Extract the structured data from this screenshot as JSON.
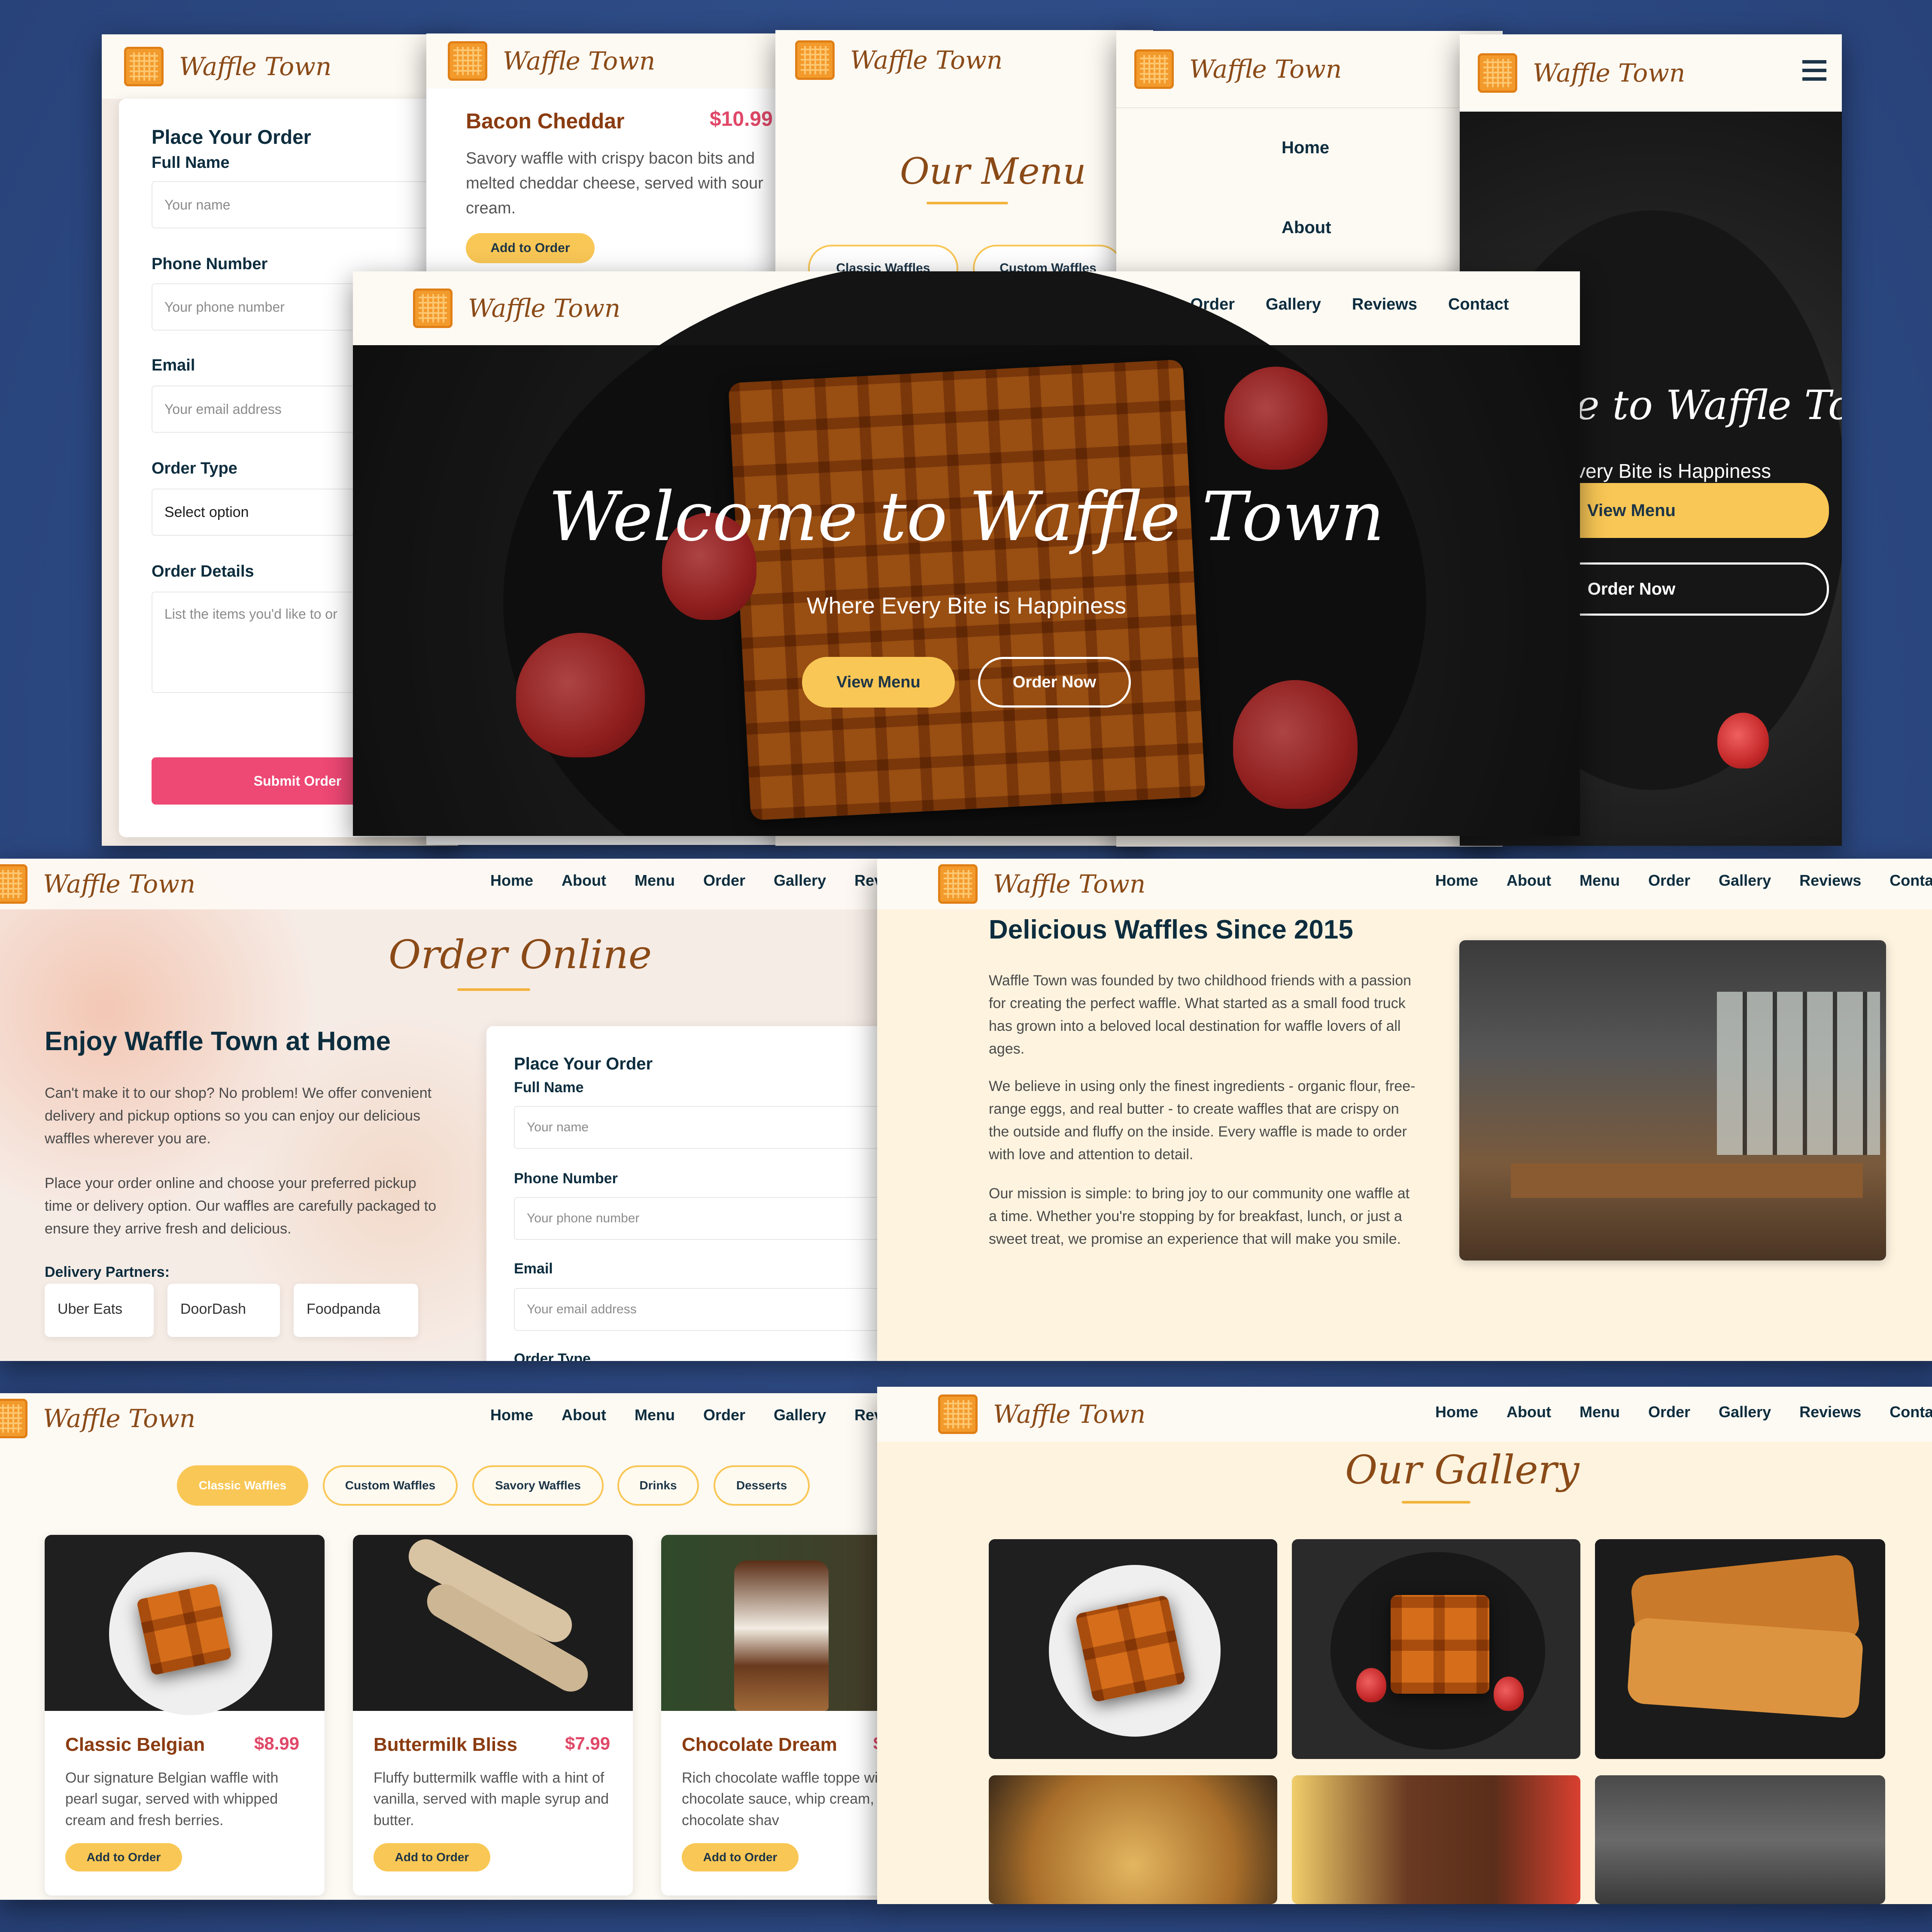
{
  "brand": {
    "name": "Waffle Town"
  },
  "nav": {
    "home": "Home",
    "about": "About",
    "menu": "Menu",
    "order": "Order",
    "gallery": "Gallery",
    "reviews": "Reviews",
    "contact": "Contact",
    "reviews_cut": "Rev",
    "contact_cut": "Contac"
  },
  "hero": {
    "title": "Welcome to Waffle Town",
    "title_cut": "e to Waffle Town",
    "subtitle": "Where Every Bite is Happiness",
    "subtitle_cut": "very Bite is Happiness",
    "view_menu": "View Menu",
    "order_now": "Order Now"
  },
  "order_form": {
    "title": "Place Your Order",
    "full_name_label": "Full Name",
    "full_name_placeholder": "Your name",
    "phone_label": "Phone Number",
    "phone_placeholder": "Your phone number",
    "email_label": "Email",
    "email_placeholder": "Your email address",
    "order_type_label": "Order Type",
    "order_type_value": "Select option",
    "order_type_cut": "Order Type",
    "details_label": "Order Details",
    "details_placeholder": "List the items you'd like to or",
    "submit": "Submit Order"
  },
  "bacon_card": {
    "title": "Bacon Cheddar",
    "price": "$10.99",
    "desc": "Savory waffle with crispy bacon bits and melted cheddar cheese, served with sour cream.",
    "button": "Add to Order"
  },
  "menu_section": {
    "title": "Our Menu",
    "chip_classic": "Classic Waffles",
    "chip_custom": "Custom Waffles",
    "chip_savory": "Savory Waffles",
    "chip_drinks": "Drinks",
    "chip_desserts": "Desserts"
  },
  "order_online": {
    "title": "Order Online",
    "heading": "Enjoy Waffle Town at Home",
    "p1": "Can't make it to our shop? No problem! We offer convenient delivery and pickup options so you can enjoy our delicious waffles wherever you are.",
    "p2": "Place your order online and choose your preferred pickup time or delivery option. Our waffles are carefully packaged to ensure they arrive fresh and delicious.",
    "partners_label": "Delivery Partners:",
    "partners": [
      "Uber Eats",
      "DoorDash",
      "Foodpanda"
    ]
  },
  "about": {
    "heading": "Delicious Waffles Since 2015",
    "p1": "Waffle Town was founded by two childhood friends with a passion for creating the perfect waffle. What started as a small food truck has grown into a beloved local destination for waffle lovers of all ages.",
    "p2": "We believe in using only the finest ingredients - organic flour, free-range eggs, and real butter - to create waffles that are crispy on the outside and fluffy on the inside. Every waffle is made to order with love and attention to detail.",
    "p3": "Our mission is simple: to bring joy to our community one waffle at a time. Whether you're stopping by for breakfast, lunch, or just a sweet treat, we promise an experience that will make you smile."
  },
  "menu_items": [
    {
      "title": "Classic Belgian",
      "price": "$8.99",
      "desc": "Our signature Belgian waffle with pearl sugar, served with whipped cream and fresh berries.",
      "button": "Add to Order"
    },
    {
      "title": "Buttermilk Bliss",
      "price": "$7.99",
      "desc": "Fluffy buttermilk waffle with a hint of vanilla, served with maple syrup and butter.",
      "button": "Add to Order"
    },
    {
      "title": "Chocolate Dream",
      "price": "$",
      "desc": "Rich chocolate waffle toppe with chocolate sauce, whip cream, and chocolate shav",
      "button": "Add to Order"
    }
  ],
  "gallery": {
    "title": "Our Gallery"
  },
  "colors": {
    "background": "#2f4c86",
    "accent_yellow": "#f9c755",
    "brand_brown": "#8a4a17",
    "price_pink": "#e04868",
    "submit_pink": "#ee4874",
    "heading_navy": "#0d2d3e",
    "cream": "#fdf3df"
  }
}
